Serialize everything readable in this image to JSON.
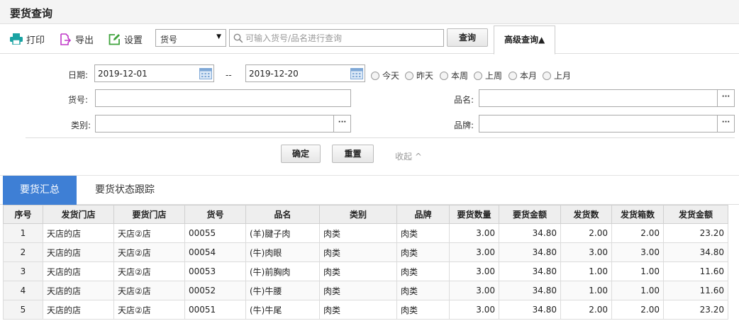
{
  "page_title": "要货查询",
  "toolbar": {
    "print_label": "打印",
    "export_label": "导出",
    "settings_label": "设置",
    "field_select": "货号",
    "search_placeholder": "可输入货号/品名进行查询",
    "query_label": "查询",
    "advanced_label": "高级查询▲"
  },
  "filters": {
    "date_label": "日期:",
    "date_from": "2019-12-01",
    "date_separator": "--",
    "date_to": "2019-12-20",
    "quick_ranges": [
      "今天",
      "昨天",
      "本周",
      "上周",
      "本月",
      "上月"
    ],
    "item_no_label": "货号:",
    "item_no_value": "",
    "product_name_label": "品名:",
    "product_name_value": "",
    "category_label": "类别:",
    "category_value": "",
    "brand_label": "品牌:",
    "brand_value": "",
    "dots": "···",
    "confirm_label": "确定",
    "reset_label": "重置",
    "collapse_label": "收起 ^"
  },
  "tabs": [
    "要货汇总",
    "要货状态跟踪"
  ],
  "table": {
    "columns": [
      "序号",
      "发货门店",
      "要货门店",
      "货号",
      "品名",
      "类别",
      "品牌",
      "要货数量",
      "要货金额",
      "发货数",
      "发货箱数",
      "发货金额"
    ],
    "rows": [
      [
        "1",
        "天店的店",
        "天店②店",
        "00055",
        "(羊)腱子肉",
        "肉类",
        "肉类",
        "3.00",
        "34.80",
        "2.00",
        "2.00",
        "23.20"
      ],
      [
        "2",
        "天店的店",
        "天店②店",
        "00054",
        "(牛)肉眼",
        "肉类",
        "肉类",
        "3.00",
        "34.80",
        "3.00",
        "3.00",
        "34.80"
      ],
      [
        "3",
        "天店的店",
        "天店②店",
        "00053",
        "(牛)前胸肉",
        "肉类",
        "肉类",
        "3.00",
        "34.80",
        "1.00",
        "1.00",
        "11.60"
      ],
      [
        "4",
        "天店的店",
        "天店②店",
        "00052",
        "(牛)牛腰",
        "肉类",
        "肉类",
        "3.00",
        "34.80",
        "1.00",
        "1.00",
        "11.60"
      ],
      [
        "5",
        "天店的店",
        "天店②店",
        "00051",
        "(牛)牛尾",
        "肉类",
        "肉类",
        "3.00",
        "34.80",
        "2.00",
        "2.00",
        "23.20"
      ]
    ]
  },
  "colors": {
    "active_tab": "#3e7fd5",
    "print_icon": "#1aa3a3",
    "export_icon": "#c038c8",
    "settings_icon": "#3fa33c",
    "calendar_icon": "#7fa8d6"
  }
}
